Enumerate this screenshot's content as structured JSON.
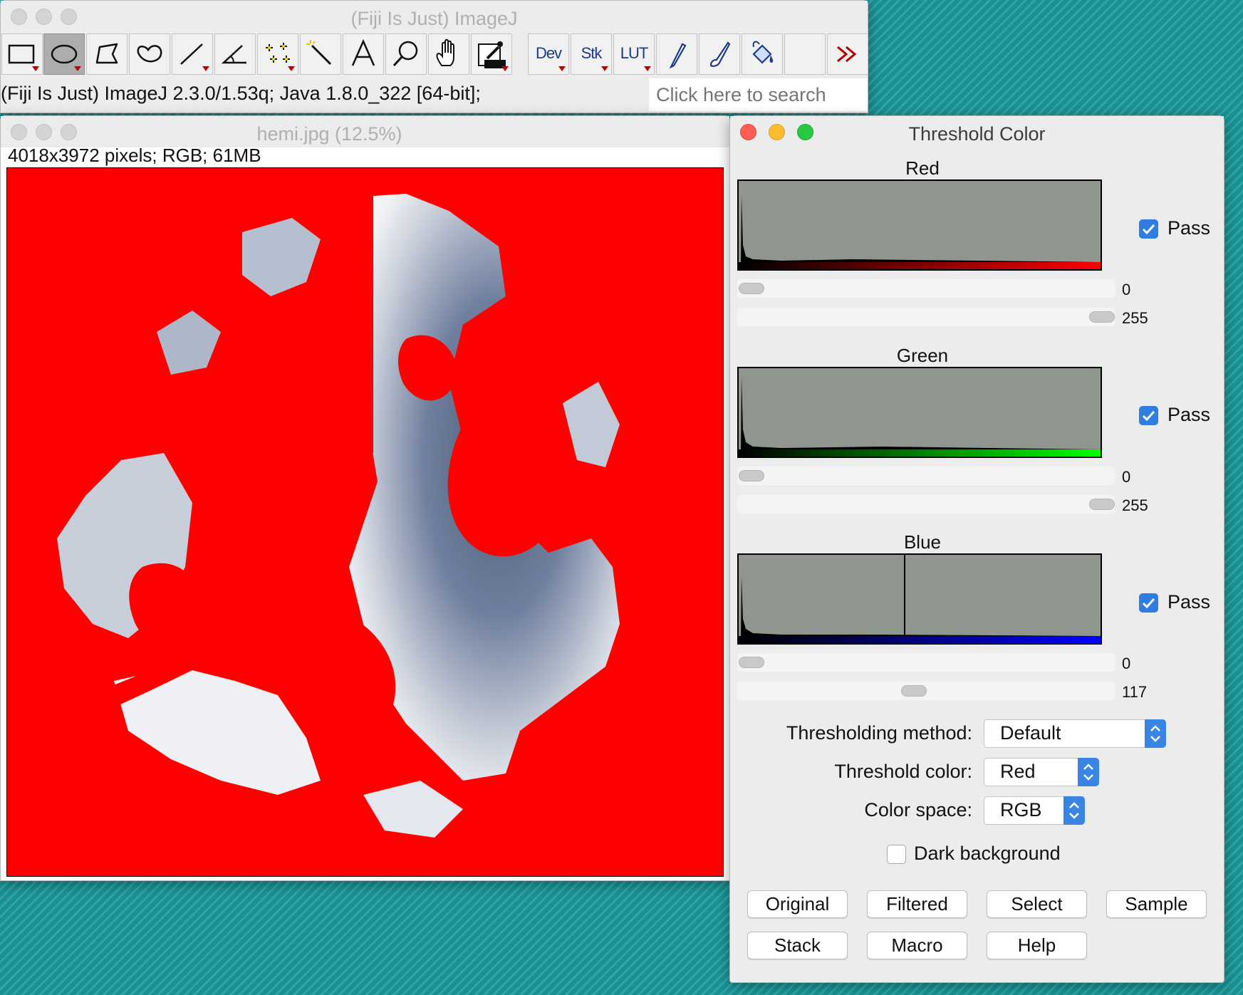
{
  "desktop": {
    "background_color": "#1a9a9c"
  },
  "main_window": {
    "title": "(Fiji Is Just) ImageJ",
    "toolbar": {
      "tools": [
        {
          "name": "rectangle-tool",
          "icon": "rectangle-icon",
          "selected": false
        },
        {
          "name": "oval-tool",
          "icon": "oval-icon",
          "selected": true
        },
        {
          "name": "polygon-tool",
          "icon": "polygon-icon",
          "selected": false
        },
        {
          "name": "freehand-tool",
          "icon": "freehand-icon",
          "selected": false
        },
        {
          "name": "line-tool",
          "icon": "line-icon",
          "selected": false
        },
        {
          "name": "angle-tool",
          "icon": "angle-icon",
          "selected": false
        },
        {
          "name": "point-tool",
          "icon": "multipoint-icon",
          "selected": false
        },
        {
          "name": "wand-tool",
          "icon": "wand-icon",
          "selected": false
        },
        {
          "name": "text-tool",
          "icon": "text-icon",
          "selected": false
        },
        {
          "name": "zoom-tool",
          "icon": "magnifier-icon",
          "selected": false
        },
        {
          "name": "scroll-tool",
          "icon": "hand-icon",
          "selected": false
        },
        {
          "name": "color-picker-tool",
          "icon": "eyedropper-icon",
          "selected": false
        },
        {
          "name": "dev-menu",
          "label": "Dev"
        },
        {
          "name": "stk-menu",
          "label": "Stk"
        },
        {
          "name": "lut-menu",
          "label": "LUT"
        },
        {
          "name": "pencil-tool",
          "icon": "pencil-icon"
        },
        {
          "name": "brush-tool",
          "icon": "brush-icon"
        },
        {
          "name": "flood-fill-tool",
          "icon": "bucket-icon"
        },
        {
          "name": "more-tools",
          "icon": "double-chevron-right-icon"
        }
      ],
      "dev_label": "Dev",
      "stk_label": "Stk",
      "lut_label": "LUT"
    },
    "status": "(Fiji Is Just) ImageJ 2.3.0/1.53q; Java 1.8.0_322 [64-bit];",
    "search_placeholder": "Click here to search"
  },
  "image_window": {
    "title": "hemi.jpg (12.5%)",
    "info": "4018x3972 pixels; RGB; 61MB",
    "threshold_overlay_color": "#ff0000"
  },
  "threshold_dialog": {
    "title": "Threshold Color",
    "channels": [
      {
        "label": "Red",
        "pass_label": "Pass",
        "pass_checked": true,
        "min": "0",
        "max": "255",
        "color": "#ff0000"
      },
      {
        "label": "Green",
        "pass_label": "Pass",
        "pass_checked": true,
        "min": "0",
        "max": "255",
        "color": "#00ff00"
      },
      {
        "label": "Blue",
        "pass_label": "Pass",
        "pass_checked": true,
        "min": "0",
        "max": "117",
        "color": "#0000ff"
      }
    ],
    "method_label": "Thresholding method:",
    "method_value": "Default",
    "color_label": "Threshold color:",
    "color_value": "Red",
    "space_label": "Color space:",
    "space_value": "RGB",
    "dark_background_label": "Dark background",
    "dark_background_checked": false,
    "buttons": [
      "Original",
      "Filtered",
      "Select",
      "Sample",
      "Stack",
      "Macro",
      "Help"
    ]
  }
}
